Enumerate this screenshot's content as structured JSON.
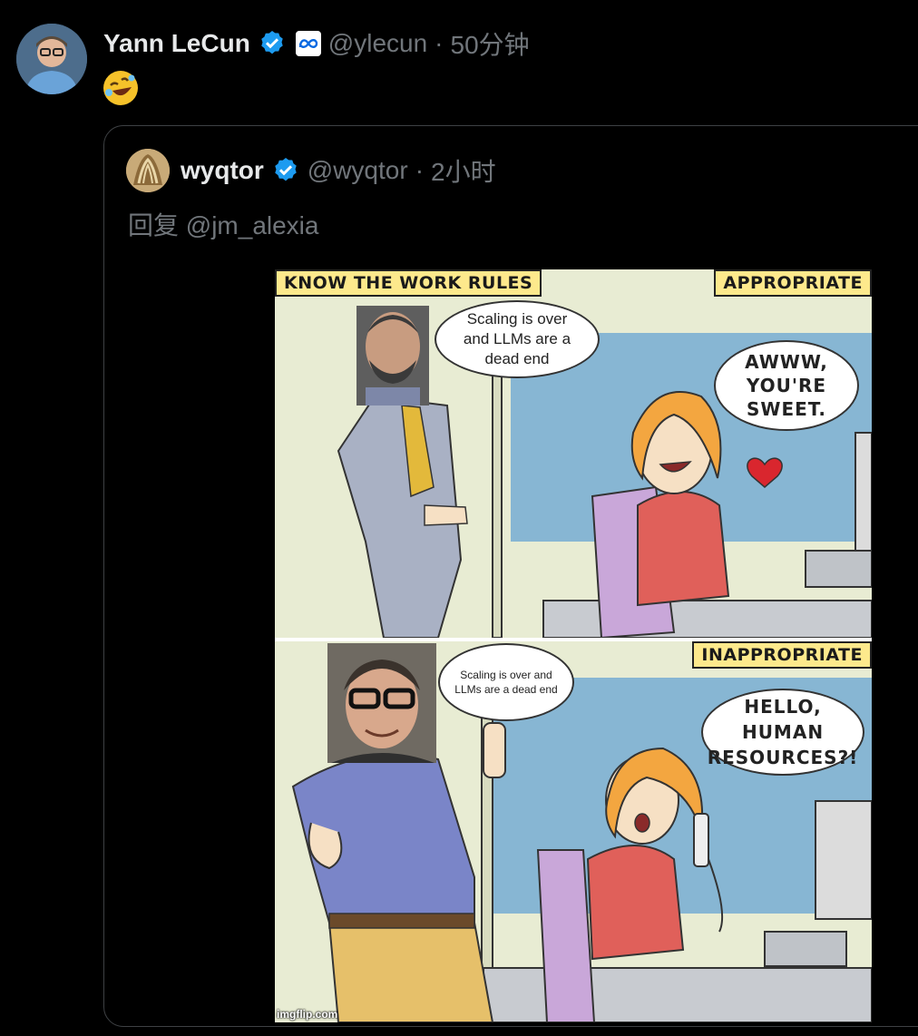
{
  "tweet": {
    "author_name": "Yann LeCun",
    "author_handle": "@ylecun",
    "separator": "·",
    "time": "50分钟",
    "body_emoji": "🤣"
  },
  "quoted": {
    "author_name": "wyqtor",
    "author_handle": "@wyqtor",
    "separator": "·",
    "time": "2小时",
    "reply_to": "回复 @jm_alexia",
    "meme": {
      "title_label": "KNOW THE WORK RULES",
      "panel1_label": "APPROPRIATE",
      "panel1_speech": "Scaling is over and LLMs are a dead end",
      "panel1_reply": "AWWW, YOU'RE SWEET.",
      "panel2_label": "INAPPROPRIATE",
      "panel2_speech": "Scaling is over and LLMs are a dead end",
      "panel2_reply": "HELLO, HUMAN RESOURCES?!",
      "watermark": "imgflip.com"
    }
  },
  "colors": {
    "verified": "#1d9bf0",
    "meta_blue": "#0668e1",
    "background": "#000000",
    "muted_text": "#71767b"
  },
  "icons": [
    "verified-badge-icon",
    "meta-logo-icon",
    "rofl-emoji-icon"
  ]
}
